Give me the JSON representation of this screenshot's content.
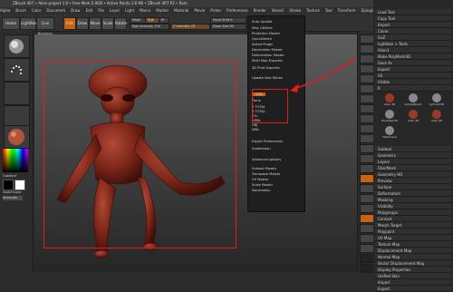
{
  "app": {
    "title": "ZBrush 4R7 • Alien project 1.0 • Free Mem 5.9GB • Active Points 1.6 Mil • ZBrush 4R7 P3 • Ram",
    "menubar": [
      "Alpha",
      "Brush",
      "Color",
      "Document",
      "Draw",
      "Edit",
      "File",
      "Layer",
      "Light",
      "Macro",
      "Marker",
      "Material",
      "Movie",
      "Picker",
      "Preferences",
      "Render",
      "Stencil",
      "Stroke",
      "Texture",
      "Tool",
      "Transform",
      "Zplugin",
      "Zscript"
    ]
  },
  "toolbar": {
    "buttons": [
      "Home Page",
      "LightBox",
      "Live Boolean",
      "Edit",
      "Draw",
      "Move",
      "Scale",
      "Rotate"
    ],
    "sliders": [
      "Mrgb",
      "Rgb",
      "M",
      "Rgb Intensity 100",
      "Z Intensity 25",
      "Focal Shift 0",
      "Draw Size 64"
    ]
  },
  "menu": {
    "title": "ZPlugin",
    "items": [
      "Auto Update",
      "Misc Utilities",
      "Projection Master",
      "QuickSketch",
      "Adjust Plugin",
      "Decimation Master",
      "Deformation Master",
      "Multi Map Exporter",
      "3D Print Exporter",
      "Update Size Ratios",
      "Unit",
      "Plane",
      "2 TOTAL",
      "3 TOTAL",
      "STL",
      "VRML",
      "OBJ",
      "WRL",
      "Export Preferences",
      "Subdivision",
      "Advanced options",
      "Subtool Master",
      "Transpose Master",
      "UV Master",
      "Scale Master",
      "Decimation"
    ]
  },
  "right_panel": {
    "top": [
      "Load Tool",
      "Copy Tool",
      "Import",
      "Clone",
      "GoZ",
      "Lightbox > Tools",
      "Alien1",
      "Make PolyMesh3D",
      "Save As",
      "Export",
      "All",
      "Visible",
      "R"
    ],
    "tools": [
      "Alien 48",
      "SimpleBrush",
      "Cylinder3D",
      "PolyMesh3D",
      "Alien 48",
      "Alien 48",
      "Fibermesh"
    ],
    "sections": [
      "Subtool",
      "Geometry",
      "Layers",
      "FiberMesh",
      "Geometry HD",
      "Preview",
      "Surface",
      "Deformation",
      "Masking",
      "Visibility",
      "Polygroups",
      "Contact",
      "Morph Target",
      "Polypaint",
      "UV Map",
      "Texture Map",
      "Displacement Map",
      "Normal Map",
      "Vector Displacement Map",
      "Display Properties",
      "Unified Skin",
      "Import",
      "Export"
    ]
  },
  "left_panel": {
    "labels": [
      "Gradient",
      "SwitchColor",
      "Alternate"
    ]
  }
}
